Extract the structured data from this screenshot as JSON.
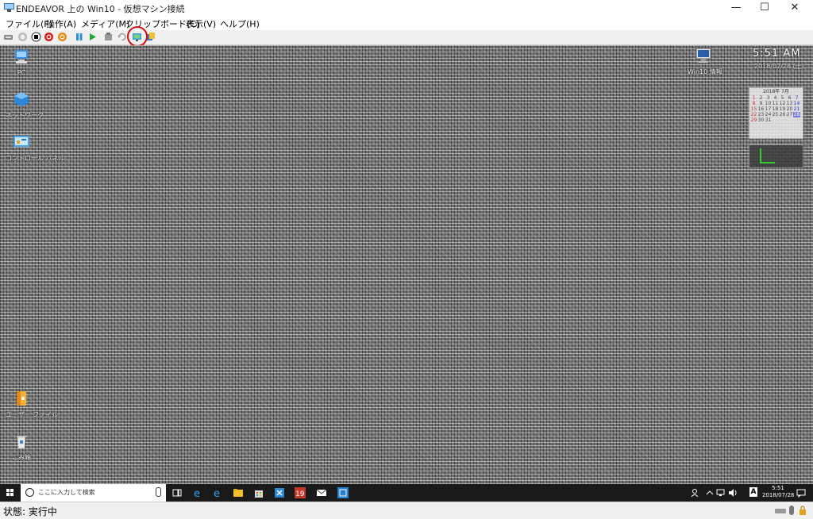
{
  "window": {
    "title": "ENDEAVOR 上の Win10 - 仮想マシン接続",
    "minimize_glyph": "—",
    "maximize_glyph": "☐",
    "close_glyph": "✕"
  },
  "menu": [
    {
      "label": "ファイル(F)"
    },
    {
      "label": "操作(A)"
    },
    {
      "label": "メディア(M)"
    },
    {
      "label": "クリップボード(C)"
    },
    {
      "label": "表示(V)"
    },
    {
      "label": "ヘルプ(H)"
    }
  ],
  "toolbar": {
    "buttons": [
      {
        "icon": "ctrl-alt-del-icon"
      },
      {
        "icon": "start-icon"
      },
      {
        "icon": "turn-off-icon"
      },
      {
        "icon": "shutdown-icon"
      },
      {
        "icon": "save-icon"
      },
      {
        "icon": "pause-icon"
      },
      {
        "icon": "resume-icon"
      },
      {
        "icon": "checkpoint-icon"
      },
      {
        "icon": "revert-icon"
      },
      {
        "icon": "enhanced-session-icon"
      },
      {
        "icon": "share-icon"
      }
    ]
  },
  "desktop": {
    "icons_left": [
      {
        "label": "PC",
        "icon": "computer-icon"
      },
      {
        "label": "ネットワーク",
        "icon": "network-icon"
      },
      {
        "label": "コントロール パネル",
        "icon": "control-panel-icon"
      },
      {
        "label": "ユーザー ファイル",
        "icon": "user-folder-icon"
      },
      {
        "label": "ごみ箱",
        "icon": "recycle-bin-icon"
      }
    ],
    "icon_right": {
      "label": "Win10 情報",
      "icon": "monitor-icon"
    },
    "clock_time": "5:51 AM",
    "clock_date": "2018/07/28 (土)",
    "calendar": {
      "header": "2018年 7月",
      "days": [
        "1",
        "2",
        "3",
        "4",
        "5",
        "6",
        "7",
        "8",
        "9",
        "10",
        "11",
        "12",
        "13",
        "14",
        "15",
        "16",
        "17",
        "18",
        "19",
        "20",
        "21",
        "22",
        "23",
        "24",
        "25",
        "26",
        "27",
        "28",
        "29",
        "30",
        "31"
      ],
      "today": "28"
    }
  },
  "taskbar": {
    "search_placeholder": "ここに入力して検索",
    "apps": [
      "task-view-icon",
      "edge-icon",
      "edge-icon",
      "file-explorer-icon",
      "store-icon",
      "app-icon",
      "app-icon",
      "mail-icon",
      "app-icon"
    ],
    "tray_icons": [
      "person-icon",
      "chevron-up-icon",
      "network-icon",
      "volume-icon",
      "ime-icon",
      "notification-icon"
    ],
    "ime_label": "A",
    "time": "5:51",
    "date": "2018/07/28"
  },
  "statusbar": {
    "status": "状態: 実行中"
  },
  "colors": {
    "annotation": "#d01010",
    "taskbar": "#1a1a1a"
  }
}
